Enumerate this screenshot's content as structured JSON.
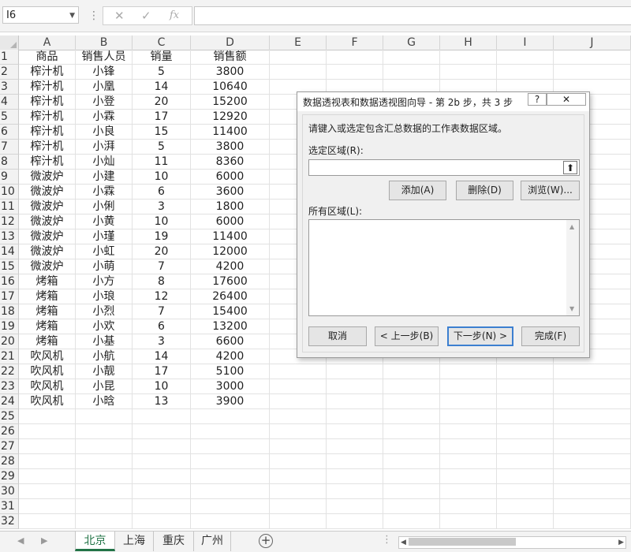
{
  "name_box": "I6",
  "formula_icons": [
    "close-icon",
    "check-icon",
    "function-icon"
  ],
  "columns": [
    "A",
    "B",
    "C",
    "D",
    "E",
    "F",
    "G",
    "H",
    "I",
    "J"
  ],
  "row_numbers": [
    "1",
    "2",
    "3",
    "4",
    "5",
    "6",
    "7",
    "8",
    "9",
    "10",
    "11",
    "12",
    "13",
    "14",
    "15",
    "16",
    "17",
    "18",
    "19",
    "20",
    "21",
    "22",
    "23",
    "24",
    "25",
    "26",
    "27",
    "28",
    "29",
    "30",
    "31",
    "32"
  ],
  "table": [
    [
      "商品",
      "销售人员",
      "销量",
      "销售额"
    ],
    [
      "榨汁机",
      "小锋",
      "5",
      "3800"
    ],
    [
      "榨汁机",
      "小凰",
      "14",
      "10640"
    ],
    [
      "榨汁机",
      "小登",
      "20",
      "15200"
    ],
    [
      "榨汁机",
      "小霖",
      "17",
      "12920"
    ],
    [
      "榨汁机",
      "小良",
      "15",
      "11400"
    ],
    [
      "榨汁机",
      "小湃",
      "5",
      "3800"
    ],
    [
      "榨汁机",
      "小灿",
      "11",
      "8360"
    ],
    [
      "微波炉",
      "小建",
      "10",
      "6000"
    ],
    [
      "微波炉",
      "小霖",
      "6",
      "3600"
    ],
    [
      "微波炉",
      "小俐",
      "3",
      "1800"
    ],
    [
      "微波炉",
      "小黄",
      "10",
      "6000"
    ],
    [
      "微波炉",
      "小瑾",
      "19",
      "11400"
    ],
    [
      "微波炉",
      "小虹",
      "20",
      "12000"
    ],
    [
      "微波炉",
      "小萌",
      "7",
      "4200"
    ],
    [
      "烤箱",
      "小方",
      "8",
      "17600"
    ],
    [
      "烤箱",
      "小琅",
      "12",
      "26400"
    ],
    [
      "烤箱",
      "小烈",
      "7",
      "15400"
    ],
    [
      "烤箱",
      "小欢",
      "6",
      "13200"
    ],
    [
      "烤箱",
      "小基",
      "3",
      "6600"
    ],
    [
      "吹风机",
      "小航",
      "14",
      "4200"
    ],
    [
      "吹风机",
      "小靓",
      "17",
      "5100"
    ],
    [
      "吹风机",
      "小昆",
      "10",
      "3000"
    ],
    [
      "吹风机",
      "小晗",
      "13",
      "3900"
    ]
  ],
  "sheet_tabs": [
    "北京",
    "上海",
    "重庆",
    "广州"
  ],
  "active_tab": "北京",
  "dialog": {
    "title": "数据透视表和数据透视图向导 - 第 2b 步，共 3 步",
    "help": "?",
    "close_icon": "close-icon",
    "instruction": "请键入或选定包含汇总数据的工作表数据区域。",
    "range_label": "选定区域(R):",
    "range_value": "",
    "add_button": "添加(A)",
    "delete_button": "删除(D)",
    "browse_button": "浏览(W)...",
    "all_ranges_label": "所有区域(L):",
    "cancel_button": "取消",
    "back_button": "< 上一步(B)",
    "next_button": "下一步(N) >",
    "finish_button": "完成(F)"
  }
}
